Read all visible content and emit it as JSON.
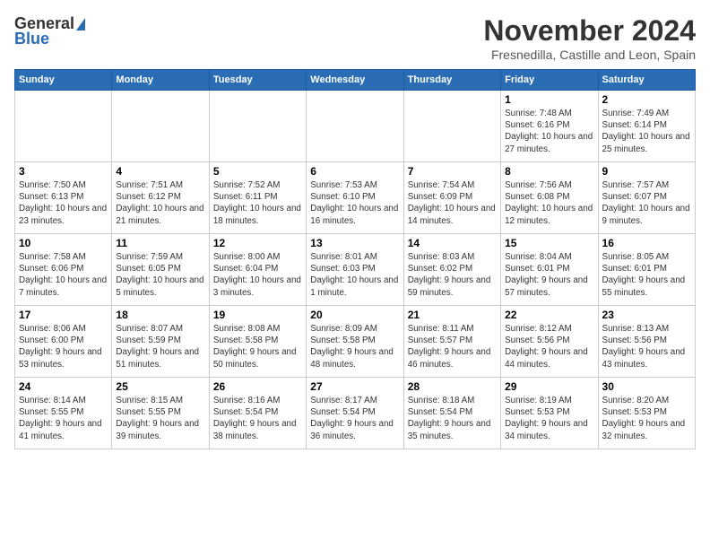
{
  "header": {
    "logo_general": "General",
    "logo_blue": "Blue",
    "month_year": "November 2024",
    "location": "Fresnedilla, Castille and Leon, Spain"
  },
  "weekdays": [
    "Sunday",
    "Monday",
    "Tuesday",
    "Wednesday",
    "Thursday",
    "Friday",
    "Saturday"
  ],
  "weeks": [
    [
      {
        "day": "",
        "info": ""
      },
      {
        "day": "",
        "info": ""
      },
      {
        "day": "",
        "info": ""
      },
      {
        "day": "",
        "info": ""
      },
      {
        "day": "",
        "info": ""
      },
      {
        "day": "1",
        "info": "Sunrise: 7:48 AM\nSunset: 6:16 PM\nDaylight: 10 hours and 27 minutes."
      },
      {
        "day": "2",
        "info": "Sunrise: 7:49 AM\nSunset: 6:14 PM\nDaylight: 10 hours and 25 minutes."
      }
    ],
    [
      {
        "day": "3",
        "info": "Sunrise: 7:50 AM\nSunset: 6:13 PM\nDaylight: 10 hours and 23 minutes."
      },
      {
        "day": "4",
        "info": "Sunrise: 7:51 AM\nSunset: 6:12 PM\nDaylight: 10 hours and 21 minutes."
      },
      {
        "day": "5",
        "info": "Sunrise: 7:52 AM\nSunset: 6:11 PM\nDaylight: 10 hours and 18 minutes."
      },
      {
        "day": "6",
        "info": "Sunrise: 7:53 AM\nSunset: 6:10 PM\nDaylight: 10 hours and 16 minutes."
      },
      {
        "day": "7",
        "info": "Sunrise: 7:54 AM\nSunset: 6:09 PM\nDaylight: 10 hours and 14 minutes."
      },
      {
        "day": "8",
        "info": "Sunrise: 7:56 AM\nSunset: 6:08 PM\nDaylight: 10 hours and 12 minutes."
      },
      {
        "day": "9",
        "info": "Sunrise: 7:57 AM\nSunset: 6:07 PM\nDaylight: 10 hours and 9 minutes."
      }
    ],
    [
      {
        "day": "10",
        "info": "Sunrise: 7:58 AM\nSunset: 6:06 PM\nDaylight: 10 hours and 7 minutes."
      },
      {
        "day": "11",
        "info": "Sunrise: 7:59 AM\nSunset: 6:05 PM\nDaylight: 10 hours and 5 minutes."
      },
      {
        "day": "12",
        "info": "Sunrise: 8:00 AM\nSunset: 6:04 PM\nDaylight: 10 hours and 3 minutes."
      },
      {
        "day": "13",
        "info": "Sunrise: 8:01 AM\nSunset: 6:03 PM\nDaylight: 10 hours and 1 minute."
      },
      {
        "day": "14",
        "info": "Sunrise: 8:03 AM\nSunset: 6:02 PM\nDaylight: 9 hours and 59 minutes."
      },
      {
        "day": "15",
        "info": "Sunrise: 8:04 AM\nSunset: 6:01 PM\nDaylight: 9 hours and 57 minutes."
      },
      {
        "day": "16",
        "info": "Sunrise: 8:05 AM\nSunset: 6:01 PM\nDaylight: 9 hours and 55 minutes."
      }
    ],
    [
      {
        "day": "17",
        "info": "Sunrise: 8:06 AM\nSunset: 6:00 PM\nDaylight: 9 hours and 53 minutes."
      },
      {
        "day": "18",
        "info": "Sunrise: 8:07 AM\nSunset: 5:59 PM\nDaylight: 9 hours and 51 minutes."
      },
      {
        "day": "19",
        "info": "Sunrise: 8:08 AM\nSunset: 5:58 PM\nDaylight: 9 hours and 50 minutes."
      },
      {
        "day": "20",
        "info": "Sunrise: 8:09 AM\nSunset: 5:58 PM\nDaylight: 9 hours and 48 minutes."
      },
      {
        "day": "21",
        "info": "Sunrise: 8:11 AM\nSunset: 5:57 PM\nDaylight: 9 hours and 46 minutes."
      },
      {
        "day": "22",
        "info": "Sunrise: 8:12 AM\nSunset: 5:56 PM\nDaylight: 9 hours and 44 minutes."
      },
      {
        "day": "23",
        "info": "Sunrise: 8:13 AM\nSunset: 5:56 PM\nDaylight: 9 hours and 43 minutes."
      }
    ],
    [
      {
        "day": "24",
        "info": "Sunrise: 8:14 AM\nSunset: 5:55 PM\nDaylight: 9 hours and 41 minutes."
      },
      {
        "day": "25",
        "info": "Sunrise: 8:15 AM\nSunset: 5:55 PM\nDaylight: 9 hours and 39 minutes."
      },
      {
        "day": "26",
        "info": "Sunrise: 8:16 AM\nSunset: 5:54 PM\nDaylight: 9 hours and 38 minutes."
      },
      {
        "day": "27",
        "info": "Sunrise: 8:17 AM\nSunset: 5:54 PM\nDaylight: 9 hours and 36 minutes."
      },
      {
        "day": "28",
        "info": "Sunrise: 8:18 AM\nSunset: 5:54 PM\nDaylight: 9 hours and 35 minutes."
      },
      {
        "day": "29",
        "info": "Sunrise: 8:19 AM\nSunset: 5:53 PM\nDaylight: 9 hours and 34 minutes."
      },
      {
        "day": "30",
        "info": "Sunrise: 8:20 AM\nSunset: 5:53 PM\nDaylight: 9 hours and 32 minutes."
      }
    ]
  ]
}
